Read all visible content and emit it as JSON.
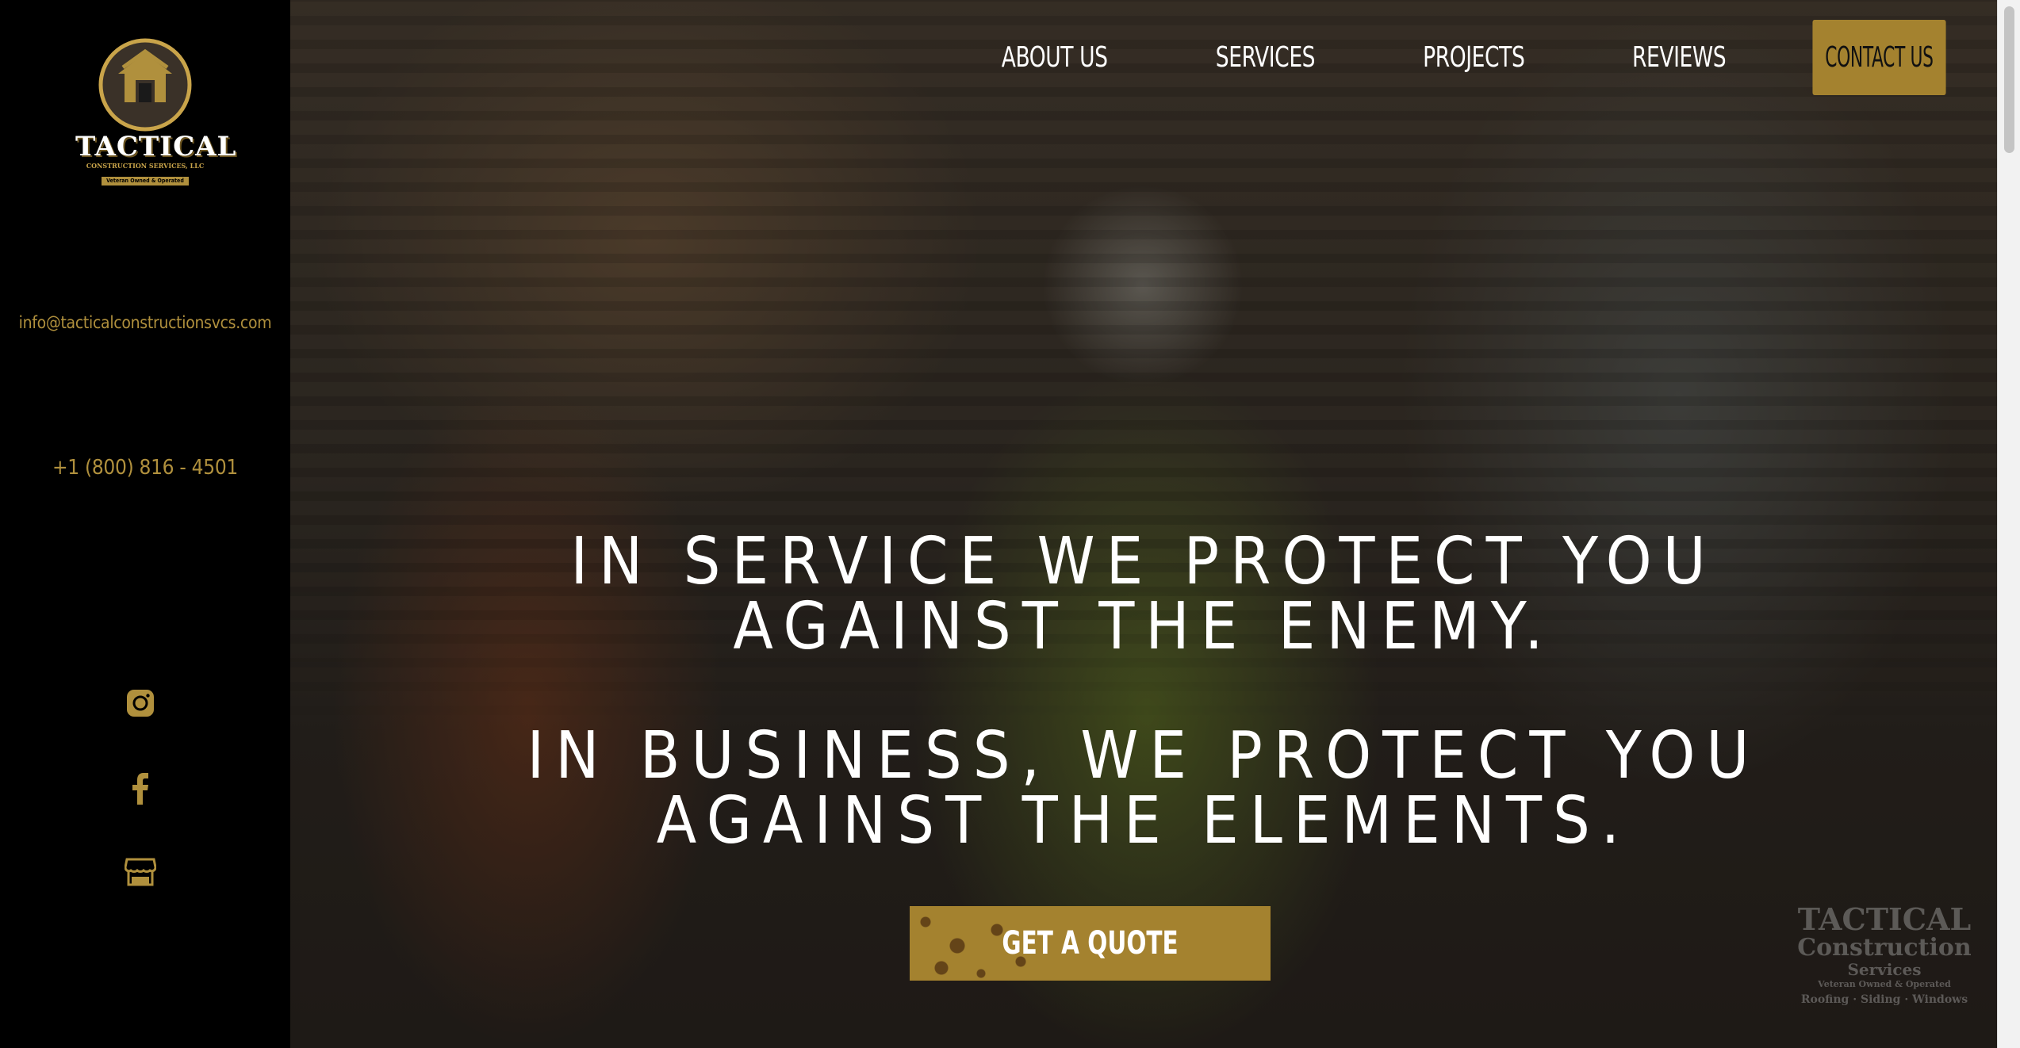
{
  "sidebar": {
    "logo": {
      "brand": "TACTICAL",
      "sub": "CONSTRUCTION SERVICES, LLC",
      "tag": "Veteran Owned & Operated"
    },
    "email": "info@tacticalconstructionsvcs.com",
    "phone": "+1 (800) 816 - 4501",
    "social": [
      "instagram-icon",
      "facebook-icon",
      "storefront-icon"
    ]
  },
  "nav": {
    "items": [
      "ABOUT US",
      "SERVICES",
      "PROJECTS",
      "REVIEWS"
    ],
    "contact": "CONTACT US"
  },
  "hero": {
    "line1": "IN SERVICE WE PROTECT YOU",
    "line2": "AGAINST THE ENEMY.",
    "line3": "IN BUSINESS, WE PROTECT YOU",
    "line4": "AGAINST THE ELEMENTS.",
    "cta": "GET A QUOTE"
  },
  "watermark": {
    "line1": "TACTICAL",
    "line2": "Construction",
    "line3": "Services",
    "line4": "Veteran Owned & Operated",
    "line5": "Roofing · Siding · Windows"
  },
  "colors": {
    "accent": "#a4822f",
    "accent_text": "#b0903d",
    "sidebar": "#000000"
  }
}
